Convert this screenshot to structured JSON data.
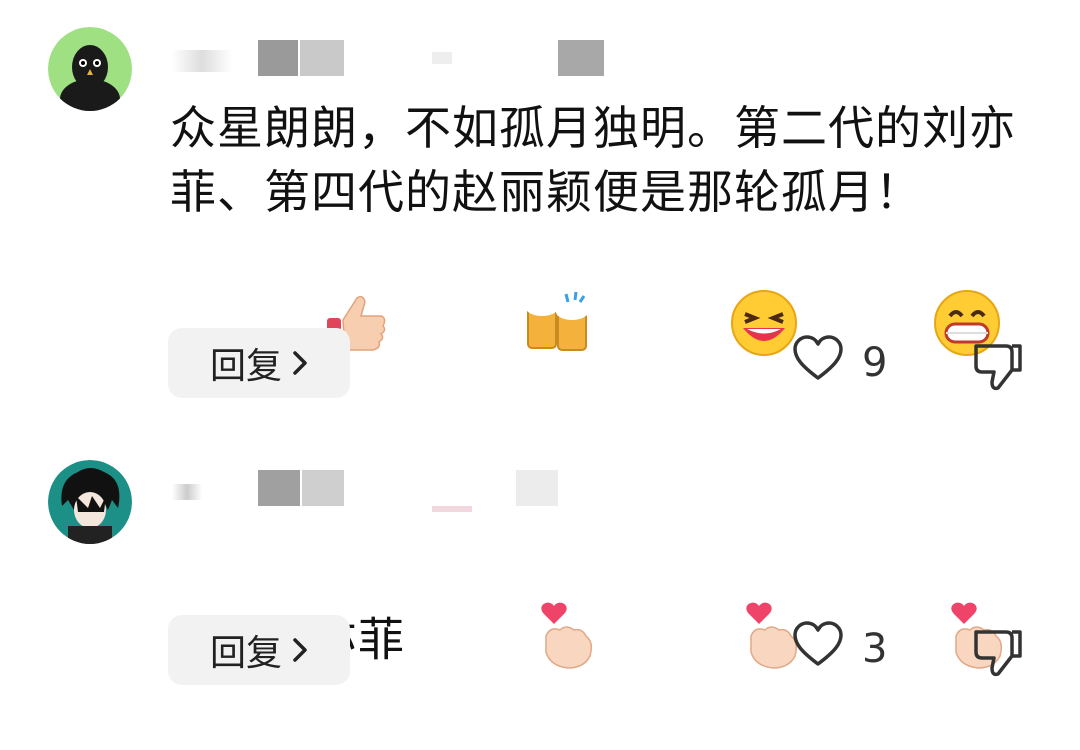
{
  "comments": [
    {
      "text": "众星朗朗，不如孤月独明。第二代的刘亦菲、第四代的赵丽颖便是那轮孤月！",
      "emojis": [
        "thumbs-up",
        "beer-mugs",
        "laughing-face",
        "grinning-face"
      ],
      "reply_label": "回复",
      "like_count": "9"
    },
    {
      "text": "只爱刘亦菲",
      "emojis": [
        "finger-heart",
        "finger-heart",
        "finger-heart"
      ],
      "reply_label": "回复",
      "like_count": "3"
    }
  ]
}
